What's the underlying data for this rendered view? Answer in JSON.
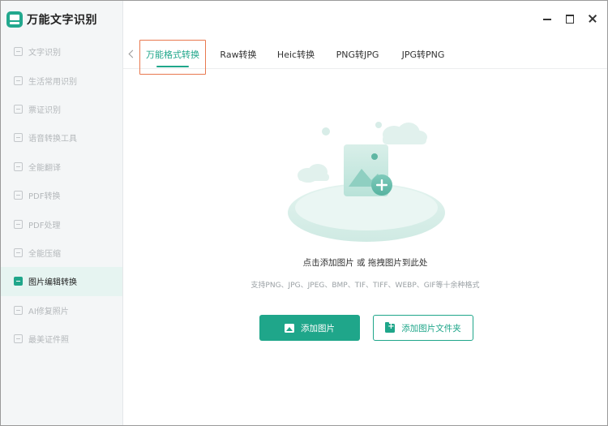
{
  "app": {
    "title": "万能文字识别"
  },
  "sidebar": {
    "items": [
      {
        "label": "文字识别",
        "icon": "text-scan-icon",
        "active": false
      },
      {
        "label": "生活常用识别",
        "icon": "life-scan-icon",
        "active": false
      },
      {
        "label": "票证识别",
        "icon": "ticket-scan-icon",
        "active": false
      },
      {
        "label": "语音转换工具",
        "icon": "voice-convert-icon",
        "active": false
      },
      {
        "label": "全能翻译",
        "icon": "translate-icon",
        "active": false
      },
      {
        "label": "PDF转换",
        "icon": "pdf-convert-icon",
        "active": false
      },
      {
        "label": "PDF处理",
        "icon": "pdf-process-icon",
        "active": false
      },
      {
        "label": "全能压缩",
        "icon": "compress-icon",
        "active": false
      },
      {
        "label": "图片编辑转换",
        "icon": "image-edit-icon",
        "active": true
      },
      {
        "label": "AI修复照片",
        "icon": "ai-repair-icon",
        "active": false
      },
      {
        "label": "最美证件照",
        "icon": "id-photo-icon",
        "active": false
      }
    ]
  },
  "window_controls": {
    "minimize_icon": "minimize-icon",
    "maximize_icon": "maximize-icon",
    "close_icon": "close-icon"
  },
  "tabs": [
    {
      "label": "万能格式转换",
      "active": true
    },
    {
      "label": "Raw转换",
      "active": false
    },
    {
      "label": "Heic转换",
      "active": false
    },
    {
      "label": "PNG转JPG",
      "active": false
    },
    {
      "label": "JPG转PNG",
      "active": false
    }
  ],
  "dropzone": {
    "hint": "点击添加图片 或 拖拽图片到此处",
    "formats": "支持PNG、JPG、JPEG、BMP、TIF、TIFF、WEBP、GIF等十余种格式"
  },
  "buttons": {
    "add_image": "添加图片",
    "add_folder": "添加图片文件夹"
  },
  "colors": {
    "accent": "#1fa68a",
    "highlight_border": "#e8784f",
    "sidebar_bg": "#f4f6f7",
    "active_item_bg": "#e6f4f1"
  }
}
